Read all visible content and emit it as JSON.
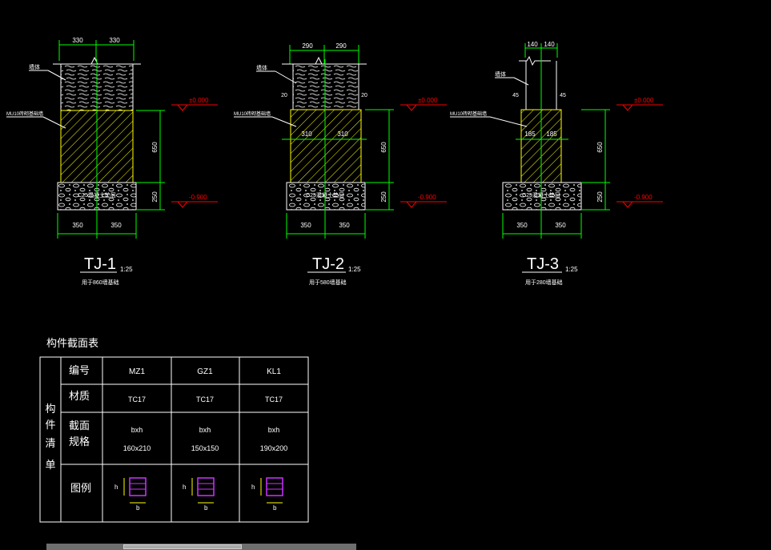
{
  "colors": {
    "bg": "#000000",
    "dim": "#00ff00",
    "struct": "#ffffff",
    "hatch": "#ffff00",
    "elev": "#ff0000",
    "legend": "#cc33ff",
    "leader": "#ffffff"
  },
  "details": [
    {
      "id": "tj1",
      "title": "TJ-1",
      "scale": "1:25",
      "subtitle": "用于860墙基础",
      "top_dims": [
        "330",
        "330"
      ],
      "bot_dims": [
        "350",
        "350"
      ],
      "side_dims": [
        "650",
        "250"
      ],
      "labels": {
        "wall": "墙体",
        "masonry": "MU10砖砌基础墙",
        "footing": "C25混凝土垫层"
      },
      "elev_top": "±0.000",
      "elev_bot": "-0.900"
    },
    {
      "id": "tj2",
      "title": "TJ-2",
      "scale": "1:25",
      "subtitle": "用于580墙基础",
      "top_dims": [
        "290",
        "290"
      ],
      "bot_dims": [
        "350",
        "350"
      ],
      "side_dims": [
        "650",
        "250"
      ],
      "mid_dims": [
        "310",
        "310"
      ],
      "offset": "20",
      "labels": {
        "wall": "墙体",
        "masonry": "MU10砖砌基础墙",
        "footing": "C25混凝土垫层"
      },
      "elev_top": "±0.000",
      "elev_bot": "-0.900"
    },
    {
      "id": "tj3",
      "title": "TJ-3",
      "scale": "1:25",
      "subtitle": "用于280墙基础",
      "top_dims": [
        "140",
        "140"
      ],
      "bot_dims": [
        "350",
        "350"
      ],
      "side_dims": [
        "650",
        "250"
      ],
      "mid_dims": [
        "185",
        "185"
      ],
      "offset": "45",
      "labels": {
        "wall": "墙体",
        "masonry": "MU10砖砌基础墙",
        "footing": "C25混凝土垫层"
      },
      "elev_top": "±0.000",
      "elev_bot": "-0.900"
    }
  ],
  "table": {
    "title": "构件截面表",
    "side_label": [
      "构",
      "件",
      "清",
      "单"
    ],
    "row_labels": [
      "编号",
      "材质",
      "截面",
      "规格",
      "图例"
    ],
    "columns": [
      {
        "id": "MZ1",
        "material": "TC17",
        "spec_head": "bxh",
        "spec": "160x210"
      },
      {
        "id": "GZ1",
        "material": "TC17",
        "spec_head": "bxh",
        "spec": "150x150"
      },
      {
        "id": "KL1",
        "material": "TC17",
        "spec_head": "bxh",
        "spec": "190x200"
      }
    ],
    "legend_h": "h",
    "legend_b": "b"
  }
}
